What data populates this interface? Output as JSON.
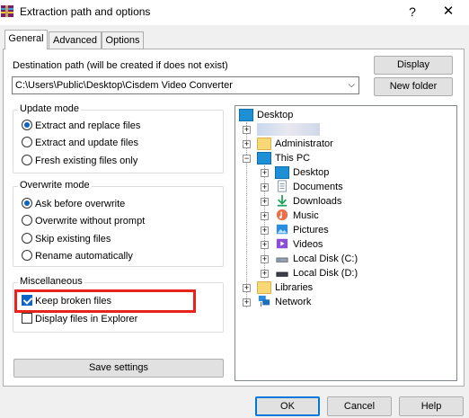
{
  "window": {
    "title": "Extraction path and options",
    "help_glyph": "?",
    "close_glyph": "✕"
  },
  "tabs": [
    {
      "label": "General",
      "active": true
    },
    {
      "label": "Advanced",
      "active": false
    },
    {
      "label": "Options",
      "active": false
    }
  ],
  "destination": {
    "label": "Destination path (will be created if does not exist)",
    "path": "C:\\Users\\Public\\Desktop\\Cisdem Video Converter",
    "display_button": "Display",
    "new_folder_button": "New folder"
  },
  "update_mode": {
    "title": "Update mode",
    "options": [
      {
        "label": "Extract and replace files",
        "selected": true
      },
      {
        "label": "Extract and update files",
        "selected": false
      },
      {
        "label": "Fresh existing files only",
        "selected": false
      }
    ]
  },
  "overwrite_mode": {
    "title": "Overwrite mode",
    "options": [
      {
        "label": "Ask before overwrite",
        "selected": true
      },
      {
        "label": "Overwrite without prompt",
        "selected": false
      },
      {
        "label": "Skip existing files",
        "selected": false
      },
      {
        "label": "Rename automatically",
        "selected": false
      }
    ]
  },
  "misc": {
    "title": "Miscellaneous",
    "keep_broken": {
      "label": "Keep broken files",
      "checked": true
    },
    "display_in_explorer": {
      "label": "Display files in Explorer",
      "checked": false
    }
  },
  "save_settings_button": "Save settings",
  "tree": {
    "root": "Desktop",
    "items": [
      {
        "label": "",
        "icon": "blurred-user-icon"
      },
      {
        "label": "Administrator",
        "icon": "folder-icon"
      },
      {
        "label": "This PC",
        "icon": "monitor-icon"
      },
      {
        "label": "Desktop",
        "icon": "desktop-icon"
      },
      {
        "label": "Documents",
        "icon": "documents-icon"
      },
      {
        "label": "Downloads",
        "icon": "downloads-icon"
      },
      {
        "label": "Music",
        "icon": "music-icon"
      },
      {
        "label": "Pictures",
        "icon": "pictures-icon"
      },
      {
        "label": "Videos",
        "icon": "videos-icon"
      },
      {
        "label": "Local Disk (C:)",
        "icon": "drive-icon"
      },
      {
        "label": "Local Disk (D:)",
        "icon": "drive-icon"
      },
      {
        "label": "Libraries",
        "icon": "folder-icon"
      },
      {
        "label": "Network",
        "icon": "network-icon"
      }
    ]
  },
  "footer": {
    "ok": "OK",
    "cancel": "Cancel",
    "help": "Help"
  },
  "colors": {
    "accent": "#0078d7",
    "highlight_box": "#e8231c"
  }
}
